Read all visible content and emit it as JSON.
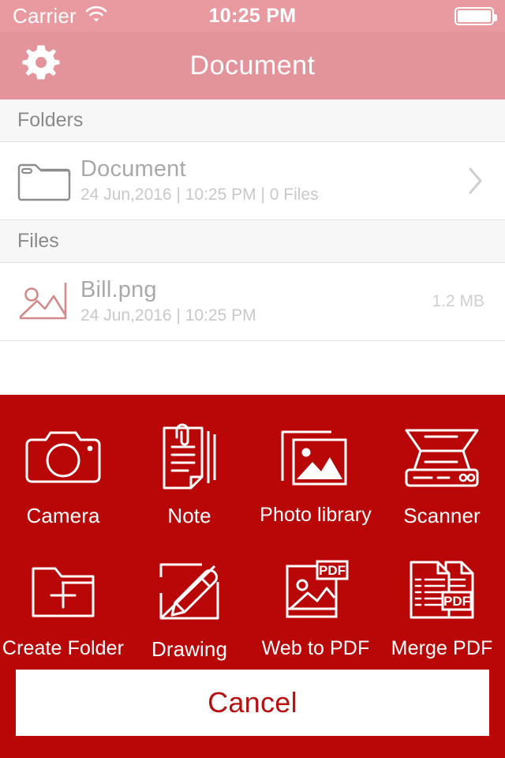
{
  "status_bar": {
    "carrier": "Carrier",
    "wifi_icon": "wifi-icon",
    "time": "10:25 PM",
    "battery_icon": "battery-full-icon"
  },
  "nav_bar": {
    "title": "Document",
    "settings_icon": "gear-icon"
  },
  "sections": [
    {
      "header": "Folders",
      "rows": [
        {
          "icon": "folder-icon",
          "title": "Document",
          "subtitle": "24 Jun,2016 | 10:25 PM | 0 Files",
          "meta": "",
          "accessory": "chevron-right-icon"
        }
      ]
    },
    {
      "header": "Files",
      "rows": [
        {
          "icon": "image-file-icon",
          "title": "Bill.png",
          "subtitle": "24 Jun,2016 | 10:25 PM",
          "meta": "1.2 MB",
          "accessory": ""
        }
      ]
    }
  ],
  "action_sheet": {
    "background_color": "#b90606",
    "items": [
      {
        "label": "Camera",
        "icon": "camera-icon"
      },
      {
        "label": "Note",
        "icon": "note-icon"
      },
      {
        "label": "Photo library",
        "icon": "photo-library-icon"
      },
      {
        "label": "Scanner",
        "icon": "scanner-icon"
      },
      {
        "label": "Create Folder",
        "icon": "create-folder-icon"
      },
      {
        "label": "Drawing",
        "icon": "drawing-icon"
      },
      {
        "label": "Web to PDF",
        "icon": "web-to-pdf-icon"
      },
      {
        "label": "Merge PDF",
        "icon": "merge-pdf-icon"
      }
    ],
    "cancel_label": "Cancel",
    "cancel_text_color": "#b61010"
  },
  "colors": {
    "status_bar": "#e89aa0",
    "nav_bar": "#e3939a",
    "sheet_red": "#b90606",
    "file_icon_pink": "#d08a8a",
    "section_header_bg": "#f7f7f7"
  },
  "icon_labels": {
    "pdf_badge": "PDF"
  }
}
